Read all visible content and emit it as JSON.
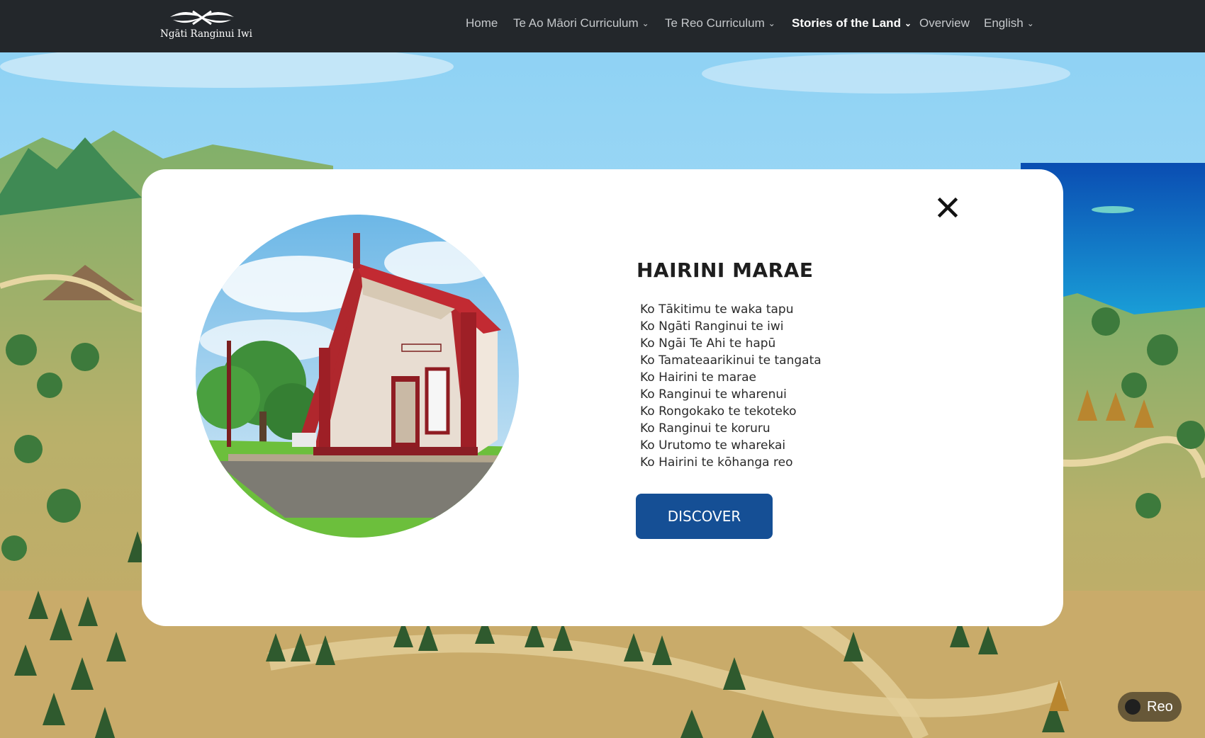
{
  "header": {
    "logo_text": "Ngāti Ranginui Iwi",
    "nav": [
      {
        "label": "Home",
        "has_dropdown": false
      },
      {
        "label": "Te Ao Māori Curriculum",
        "has_dropdown": true
      },
      {
        "label": "Te Reo Curriculum",
        "has_dropdown": true
      },
      {
        "label": "Stories of the Land",
        "has_dropdown": true,
        "active": true
      },
      {
        "label": "Overview",
        "has_dropdown": false
      },
      {
        "label": "English",
        "has_dropdown": true
      }
    ],
    "dropdown_icon": "chevron-down-icon"
  },
  "modal": {
    "title": "HAIRINI MARAE",
    "lines": [
      "Ko Tākitimu te waka tapu",
      "Ko Ngāti Ranginui te iwi",
      "Ko Ngāi Te Ahi te hapū",
      "Ko Tamateaarikinui te tangata",
      "Ko Hairini te marae",
      "Ko Ranginui te wharenui",
      "Ko Rongokako te tekoteko",
      "Ko Ranginui te koruru",
      "Ko Urutomo te wharekai",
      "Ko Hairini te kōhanga reo"
    ],
    "discover_label": "DISCOVER",
    "close_icon": "close-icon"
  },
  "toggle": {
    "label": "Reo"
  },
  "colors": {
    "nav_bg": "#23272b",
    "nav_text": "#c5c8cb",
    "nav_active": "#ffffff",
    "button_blue": "#154f95",
    "modal_bg": "#ffffff"
  }
}
